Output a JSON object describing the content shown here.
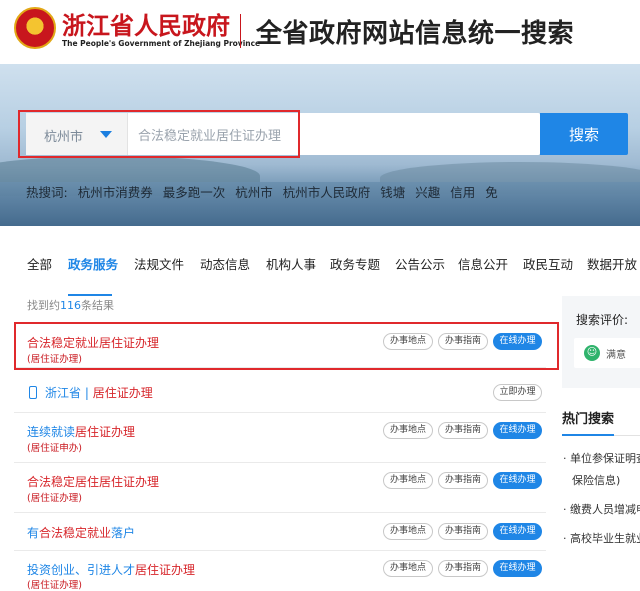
{
  "header": {
    "gov_name": "浙江省人民政府",
    "gov_english": "The People's Government of Zhejiang Province",
    "site_title": "全省政府网站信息统一搜索"
  },
  "search": {
    "city": "杭州市",
    "query": "合法稳定就业居住证办理",
    "button_label": "搜索"
  },
  "hot_words": {
    "label": "热搜词:",
    "items": [
      "杭州市消费券",
      "最多跑一次",
      "杭州市",
      "杭州市人民政府",
      "钱塘",
      "兴趣",
      "信用",
      "免"
    ]
  },
  "tabs": [
    {
      "label": "全部"
    },
    {
      "label": "政务服务",
      "active": true
    },
    {
      "label": "法规文件"
    },
    {
      "label": "动态信息"
    },
    {
      "label": "机构人事"
    },
    {
      "label": "政务专题"
    },
    {
      "label": "公告公示"
    },
    {
      "label": "信息公开"
    },
    {
      "label": "政民互动"
    },
    {
      "label": "数据开放"
    }
  ],
  "result_count": {
    "prefix": "找到约",
    "number": "116",
    "suffix": "条结果"
  },
  "actions": {
    "location": "办事地点",
    "guide": "办事指南",
    "online": "在线办理",
    "immediate": "立即办理"
  },
  "results": [
    {
      "title": "合法稳定就业居住证办理",
      "sub": "(居住证办理)"
    },
    {
      "title_a": "浙江省",
      "title_sep": " | ",
      "title_b": "居住证办理"
    },
    {
      "title_a": "连续就读",
      "title_b": "居住证办理",
      "sub": "(居住证申办)"
    },
    {
      "title_a": "合法稳定居住",
      "title_b": "居住证办理",
      "sub": "(居住证办理)"
    },
    {
      "title_a": "有",
      "title_b": "合法稳定就业",
      "title_c": "落户"
    },
    {
      "title_a": "投资创业、引进人才",
      "title_b": "居住证办理",
      "sub": "(居住证办理)"
    }
  ],
  "rating": {
    "label": "搜索评价:",
    "option": "满意"
  },
  "hot_search": {
    "title": "热门搜索",
    "items": [
      "单位参保证明查询",
      "保险信息)",
      "缴费人员增减申报",
      "高校毕业生就业"
    ]
  },
  "colors": {
    "accent": "#1f86e6",
    "highlight": "#e0292c",
    "link_red": "#d7262b"
  }
}
